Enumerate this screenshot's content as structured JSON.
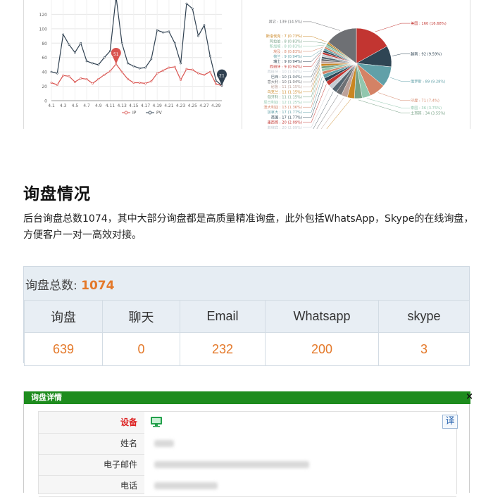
{
  "chart_data": [
    {
      "type": "line",
      "x": [
        "4.1",
        "4.2",
        "4.3",
        "4.4",
        "4.5",
        "4.6",
        "4.7",
        "4.8",
        "4.9",
        "4.10",
        "4.11",
        "4.12",
        "4.13",
        "4.14",
        "4.15",
        "4.16",
        "4.17",
        "4.18",
        "4.19",
        "4.20",
        "4.21",
        "4.22",
        "4.23",
        "4.24",
        "4.25",
        "4.26",
        "4.27",
        "4.28",
        "4.29",
        "4.30"
      ],
      "tick_labels": [
        "4.1",
        "4.3",
        "4.5",
        "4.7",
        "4.9",
        "4.11",
        "4.13",
        "4.15",
        "4.17",
        "4.19",
        "4.21",
        "4.23",
        "4.25",
        "4.27",
        "4.29"
      ],
      "y_ticks": [
        0,
        20,
        40,
        60,
        80,
        100,
        120
      ],
      "ylim": [
        0,
        140
      ],
      "series": [
        {
          "name": "IP",
          "color": "#d9534f",
          "values": [
            25,
            22,
            35,
            34,
            26,
            31,
            30,
            24,
            30,
            36,
            41,
            51,
            40,
            30,
            25,
            25,
            24,
            27,
            38,
            42,
            46,
            47,
            29,
            44,
            43,
            38,
            36,
            40,
            23,
            21
          ]
        },
        {
          "name": "PV",
          "color": "#2f4050",
          "values": [
            40,
            38,
            92,
            78,
            67,
            80,
            55,
            52,
            50,
            60,
            69,
            145,
            80,
            52,
            48,
            45,
            46,
            58,
            98,
            95,
            96,
            80,
            52,
            135,
            128,
            90,
            105,
            62,
            28,
            21
          ]
        }
      ],
      "callouts": [
        {
          "series": "IP",
          "x": "4.12",
          "label": "51"
        },
        {
          "series": "PV",
          "x": "4.30",
          "label": "21"
        }
      ],
      "grid": true,
      "legend": "bottom"
    },
    {
      "type": "pie",
      "slices": [
        {
          "label": "美国 : 160 (16.68%)",
          "value": 160,
          "color": "#c23531"
        },
        {
          "label": "越南 : 92 (9.59%)",
          "value": 92,
          "color": "#2f4554"
        },
        {
          "label": "俄罗斯 : 89 (9.28%)",
          "value": 89,
          "color": "#61a0a8"
        },
        {
          "label": "印度 : 71 (7.4%)",
          "value": 71,
          "color": "#d48265"
        },
        {
          "label": "泰国 : 36 (3.75%)",
          "value": 36,
          "color": "#91c7ae"
        },
        {
          "label": "土耳其 : 34 (3.55%)",
          "value": 34,
          "color": "#749f83"
        },
        {
          "label": "德国 : 31 (3.23%)",
          "value": 31,
          "color": "#ca8622"
        },
        {
          "label": "伊朗 : 27 (2.82%)",
          "value": 27,
          "color": "#bda29a"
        },
        {
          "label": "韩国 : 25 (2.61%)",
          "value": 25,
          "color": "#6e7074"
        },
        {
          "label": "日本 : 23 (2.4%)",
          "value": 23,
          "color": "#546570"
        },
        {
          "label": "菲律宾 : 20 (2.09%)",
          "value": 20,
          "color": "#c4ccd3"
        },
        {
          "label": "墨西哥 : 20 (2.09%)",
          "value": 20,
          "color": "#c23531"
        },
        {
          "label": "英国 : 17 (1.77%)",
          "value": 17,
          "color": "#2f4554"
        },
        {
          "label": "加拿大 : 17 (1.77%)",
          "value": 17,
          "color": "#61a0a8"
        },
        {
          "label": "澳大利亚 : 13 (1.36%)",
          "value": 13,
          "color": "#d48265"
        },
        {
          "label": "尼日利亚 : 12 (1.25%)",
          "value": 12,
          "color": "#91c7ae"
        },
        {
          "label": "匈牙利 : 11 (1.15%)",
          "value": 11,
          "color": "#749f83"
        },
        {
          "label": "乌克兰 : 11 (1.15%)",
          "value": 11,
          "color": "#ca8622"
        },
        {
          "label": "秘鲁 : 11 (1.15%)",
          "value": 11,
          "color": "#bda29a"
        },
        {
          "label": "意大利 : 10 (1.04%)",
          "value": 10,
          "color": "#6e7074"
        },
        {
          "label": "巴西 : 10 (1.04%)",
          "value": 10,
          "color": "#546570"
        },
        {
          "label": "西班牙 : 10 (1.04%)",
          "value": 10,
          "color": "#c4ccd3"
        },
        {
          "label": "西班牙 : 9 (0.94%)",
          "value": 9,
          "color": "#c23531"
        },
        {
          "label": "瑞士 : 9 (0.94%)",
          "value": 9,
          "color": "#2f4554"
        },
        {
          "label": "荷兰 : 9 (0.94%)",
          "value": 9,
          "color": "#61a0a8"
        },
        {
          "label": "埃及 : 8 (0.83%)",
          "value": 8,
          "color": "#d48265"
        },
        {
          "label": "新加坡 : 8 (0.83%)",
          "value": 8,
          "color": "#91c7ae"
        },
        {
          "label": "阿拉伯 : 8 (0.83%)",
          "value": 8,
          "color": "#749f83"
        },
        {
          "label": "斯洛伐克 : 7 (0.73%)",
          "value": 7,
          "color": "#ca8622"
        },
        {
          "label": "其它 : 139 (14.5%)",
          "value": 139,
          "color": "#6e7074"
        }
      ]
    }
  ],
  "section": {
    "title": "询盘情况",
    "desc": "后台询盘总数1074，其中大部分询盘都是高质量精准询盘，此外包括WhatsApp，Skype的在线询盘，方便客户一对一高效对接。"
  },
  "summary": {
    "title_label": "询盘总数: ",
    "total": "1074",
    "headers": [
      "询盘",
      "聊天",
      "Email",
      "Whatsapp",
      "skype"
    ],
    "values": [
      "639",
      "0",
      "232",
      "200",
      "3"
    ]
  },
  "detail": {
    "header": "询盘详情",
    "close": "×",
    "device_label": "设备",
    "name_label": "姓名",
    "email_label": "电子邮件",
    "phone_label": "电话",
    "translate": "译"
  }
}
